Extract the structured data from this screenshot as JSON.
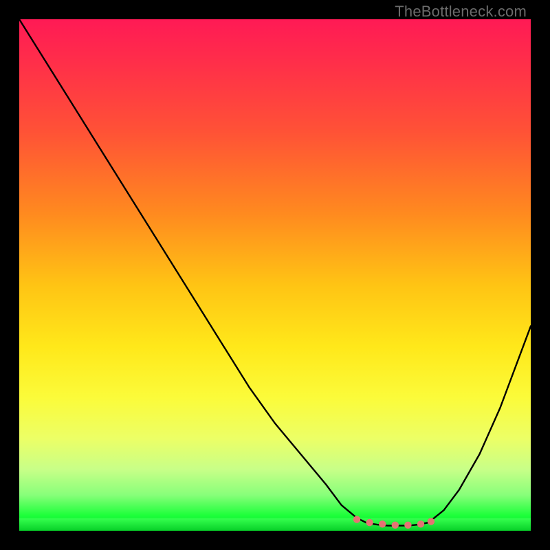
{
  "watermark": "TheBottleneck.com",
  "colors": {
    "frame": "#000000",
    "curve": "#000000",
    "marker": "#e57373",
    "gradient_top": "#ff1a55",
    "gradient_bottom": "#07d028"
  },
  "chart_data": {
    "type": "line",
    "title": "",
    "xlabel": "",
    "ylabel": "",
    "x_range": [
      0,
      100
    ],
    "y_range": [
      0,
      100
    ],
    "note": "y is visual height (0 = bottom/best, 100 = top/worst); curve is a V-shaped bottleneck profile with minimum plateau around x≈68–80",
    "series": [
      {
        "name": "bottleneck-curve",
        "x": [
          0,
          5,
          10,
          15,
          20,
          25,
          30,
          35,
          40,
          45,
          50,
          55,
          60,
          63,
          66,
          68,
          70,
          72,
          74,
          76,
          78,
          80,
          83,
          86,
          90,
          94,
          100
        ],
        "values": [
          100,
          92,
          84,
          76,
          68,
          60,
          52,
          44,
          36,
          28,
          21,
          15,
          9,
          5,
          2.5,
          1.5,
          1.2,
          1.0,
          1.0,
          1.0,
          1.2,
          1.6,
          4,
          8,
          15,
          24,
          40
        ]
      }
    ],
    "markers": {
      "name": "optimal-range-markers",
      "x": [
        66,
        68.5,
        71,
        73.5,
        76,
        78.5,
        80.5
      ],
      "values": [
        2.2,
        1.6,
        1.3,
        1.1,
        1.1,
        1.3,
        1.8
      ]
    }
  }
}
